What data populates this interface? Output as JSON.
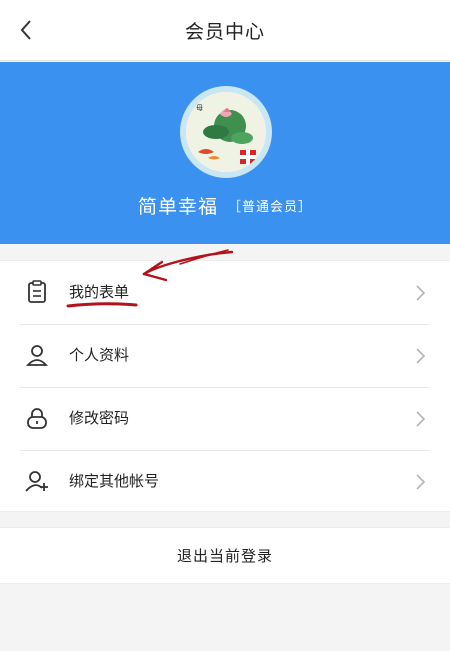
{
  "header": {
    "title": "会员中心"
  },
  "profile": {
    "name": "简单幸福",
    "level": "［普通会员］"
  },
  "menu": {
    "items": [
      {
        "label": "我的表单",
        "icon": "clipboard-icon"
      },
      {
        "label": "个人资料",
        "icon": "user-icon"
      },
      {
        "label": "修改密码",
        "icon": "lock-icon"
      },
      {
        "label": "绑定其他帐号",
        "icon": "user-add-icon"
      }
    ]
  },
  "logout": {
    "label": "退出当前登录"
  },
  "colors": {
    "hero_blue": "#3b91f0",
    "annotation_red": "#b3121a"
  }
}
